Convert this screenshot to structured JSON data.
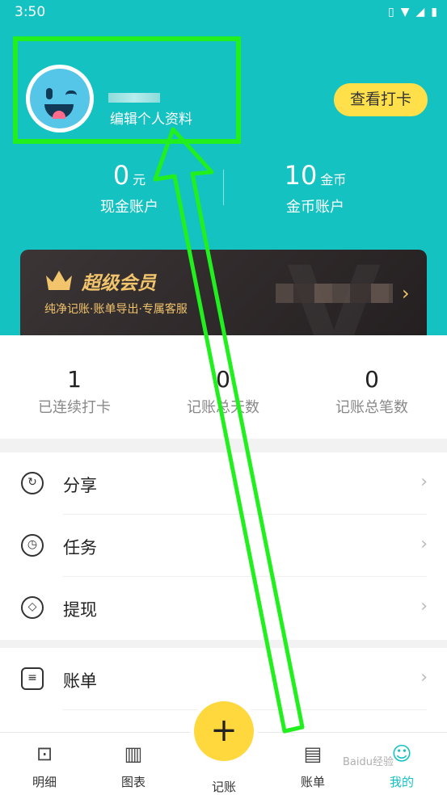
{
  "status_bar": {
    "time": "3:50"
  },
  "profile": {
    "edit_label": "编辑个人资料",
    "checkin_button": "查看打卡"
  },
  "accounts": {
    "cash": {
      "value": "0",
      "unit": "元",
      "label": "现金账户"
    },
    "coin": {
      "value": "10",
      "unit": "金币",
      "label": "金币账户"
    }
  },
  "vip": {
    "title": "超级会员",
    "subtitle": "纯净记账·账单导出·专属客服"
  },
  "stats": [
    {
      "value": "1",
      "label": "已连续打卡"
    },
    {
      "value": "0",
      "label": "记账总天数"
    },
    {
      "value": "0",
      "label": "记账总笔数"
    }
  ],
  "menu": [
    {
      "label": "分享",
      "icon": "share-icon"
    },
    {
      "label": "任务",
      "icon": "clock-icon"
    },
    {
      "label": "提现",
      "icon": "withdraw-icon"
    },
    {
      "label": "账单",
      "icon": "bill-icon"
    }
  ],
  "tabbar": [
    {
      "label": "明细",
      "icon": "detail-icon"
    },
    {
      "label": "图表",
      "icon": "chart-icon"
    },
    {
      "label": "记账",
      "icon": "plus-icon"
    },
    {
      "label": "账单",
      "icon": "bill-icon"
    },
    {
      "label": "我的",
      "icon": "mine-icon"
    }
  ],
  "watermark": "Baidu经验",
  "colors": {
    "primary": "#15c2c2",
    "accent": "#ffd83d",
    "annotation": "#22f01e"
  }
}
